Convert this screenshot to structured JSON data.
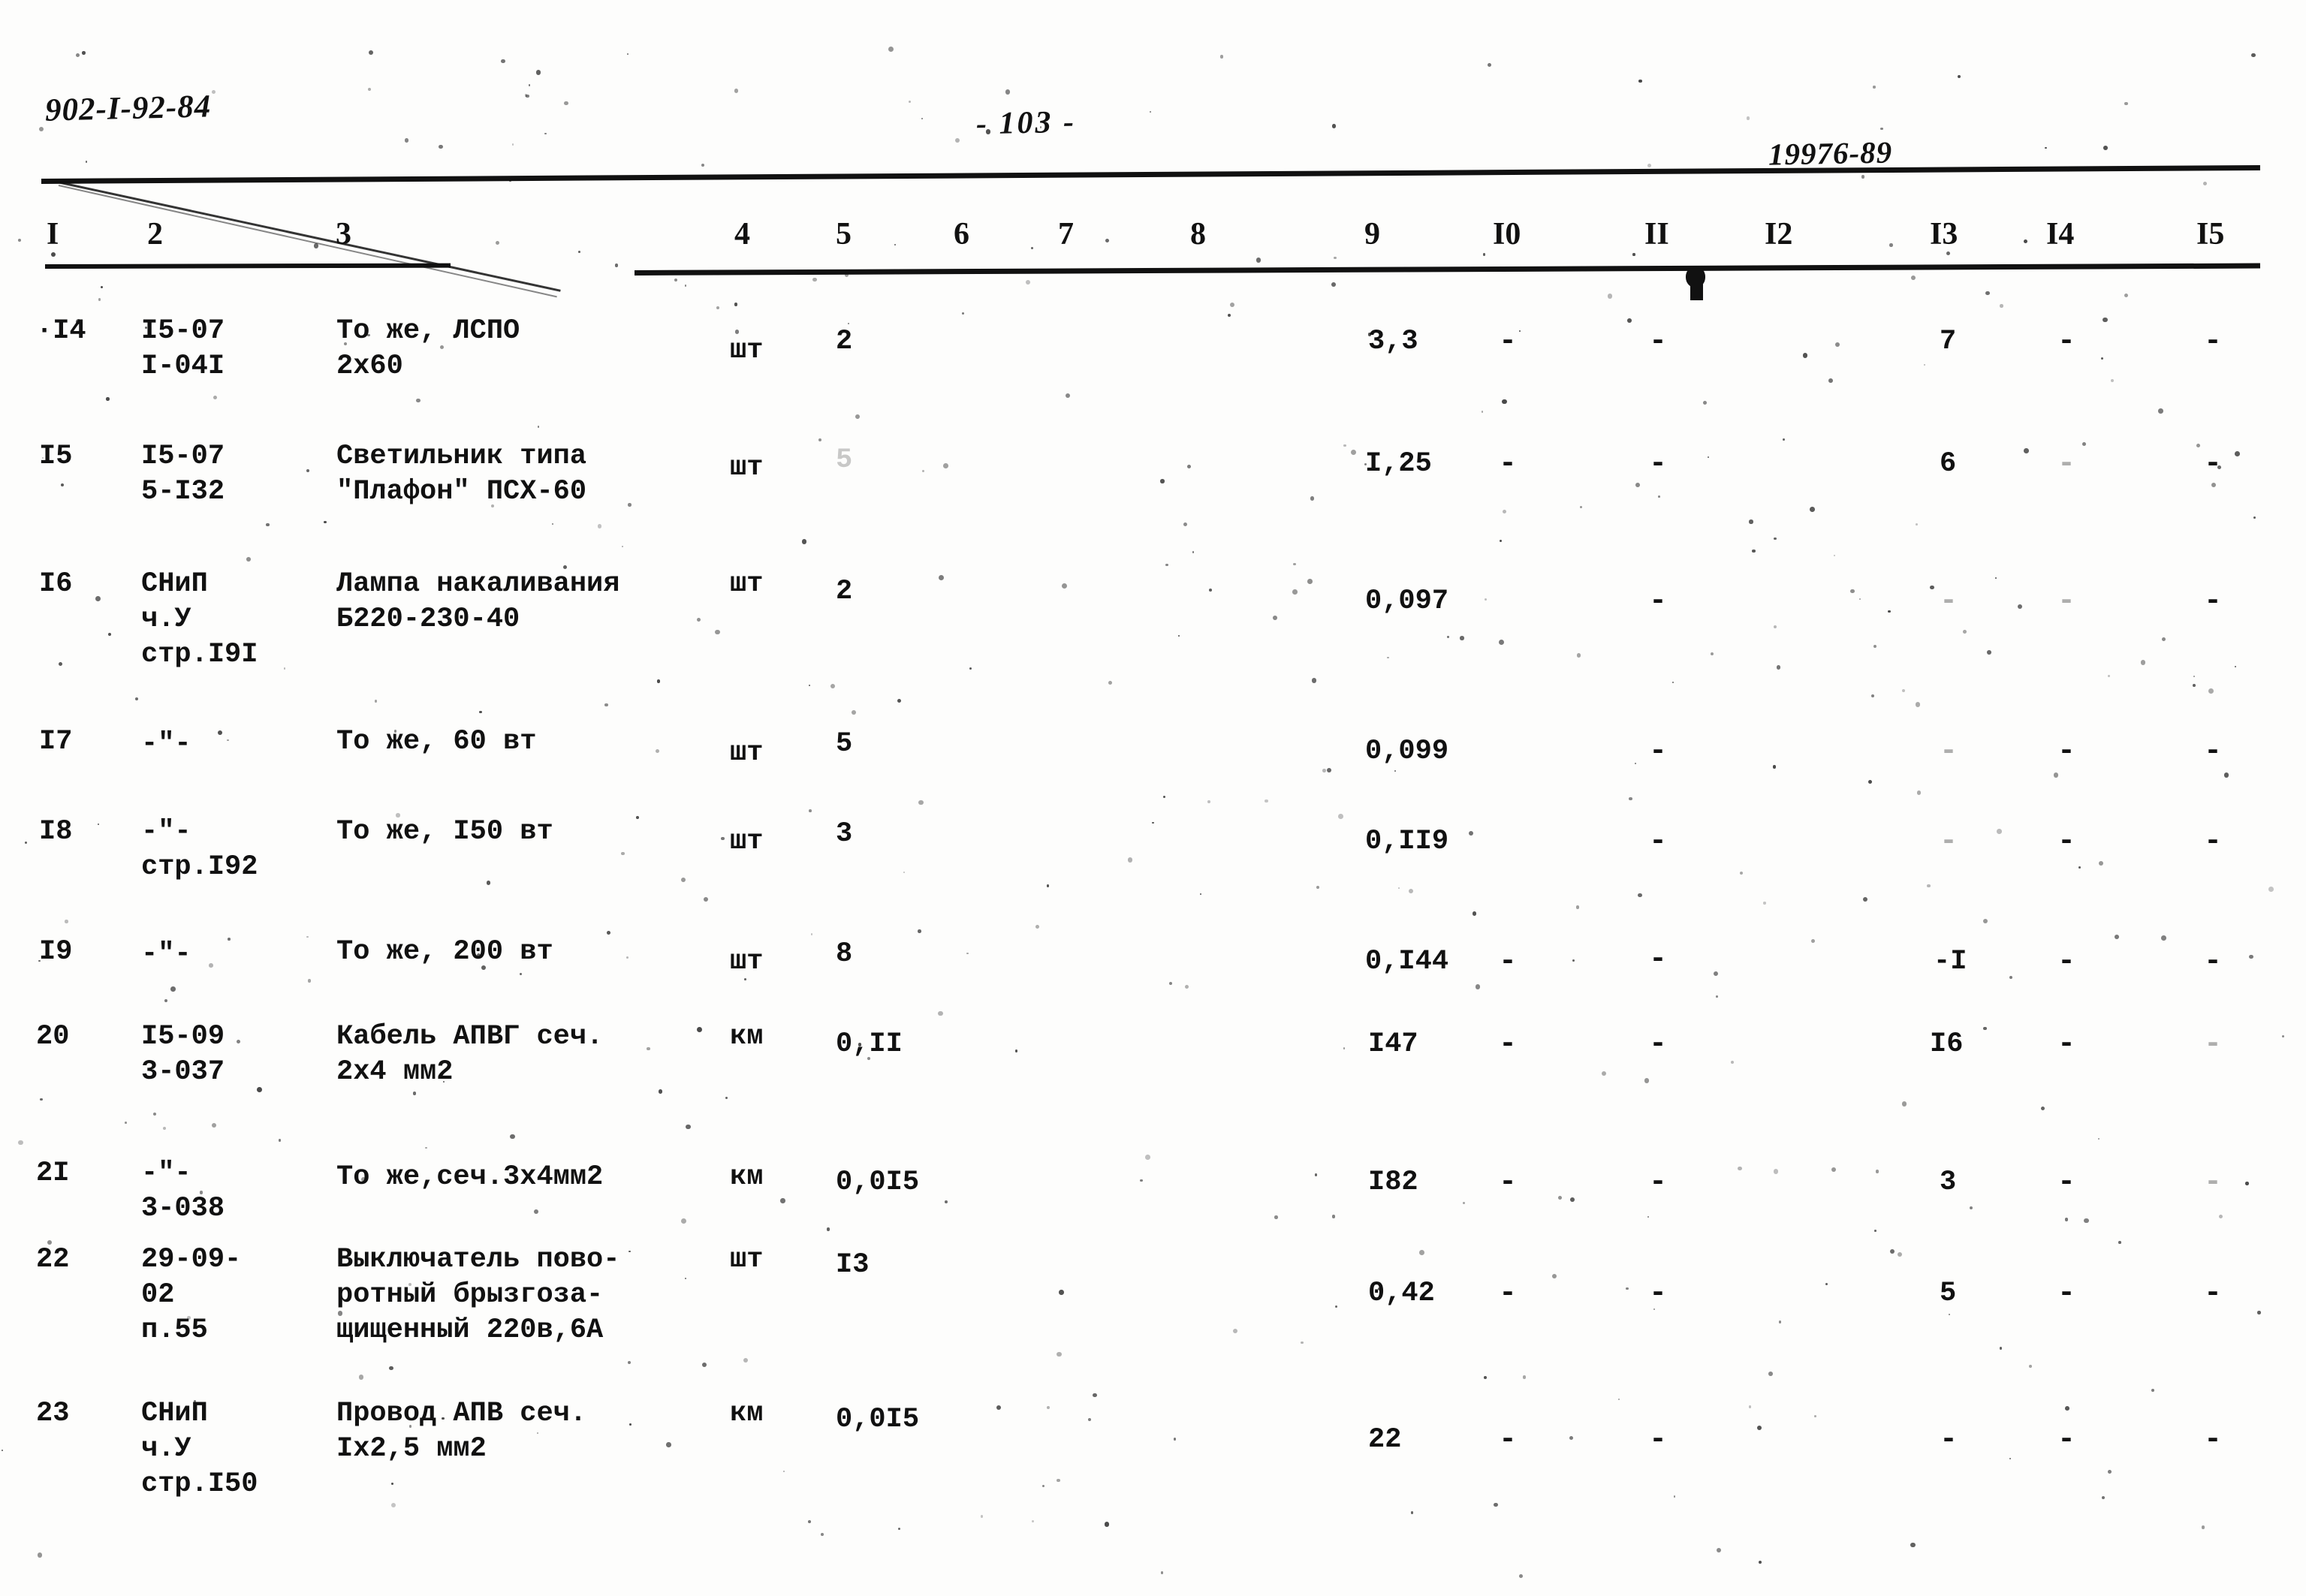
{
  "header": {
    "left_code": "902-I-92-84",
    "page_number": "- 103 -",
    "right_code": "19976-89"
  },
  "table": {
    "column_headers": [
      "I",
      "2",
      "3",
      "4",
      "5",
      "6",
      "7",
      "8",
      "9",
      "I0",
      "II",
      "I2",
      "I3",
      "I4",
      "I5"
    ],
    "rows": [
      {
        "c1": "·I4",
        "c2": "I5-07\nI-04I",
        "c3": "То же, ЛСПО\n2х60",
        "c4": "шт",
        "c5": "2",
        "c6": "",
        "c7": "",
        "c8": "",
        "c9": "3,3",
        "c10": "-",
        "c11": "-",
        "c12": "",
        "c13": "7",
        "c14": "-",
        "c15": "-"
      },
      {
        "c1": "I5",
        "c2": "I5-07\n5-I32",
        "c3": "Светильник типа\n\"Плафон\" ПСХ-60",
        "c4": "шт",
        "c5": "5",
        "c6": "",
        "c7": "",
        "c8": "",
        "c9": "I,25",
        "c10": "-",
        "c11": "-",
        "c12": "",
        "c13": "6",
        "c14": "-",
        "c15": "-"
      },
      {
        "c1": "I6",
        "c2": "СНиП\nч.У\nстр.I9I",
        "c3": "Лампа накаливания\nБ220-230-40",
        "c4": "шт",
        "c5": "2",
        "c6": "",
        "c7": "",
        "c8": "",
        "c9": "0,097",
        "c10": "",
        "c11": "-",
        "c12": "",
        "c13": "-",
        "c14": "-",
        "c15": "-"
      },
      {
        "c1": "I7",
        "c2": "-\"-",
        "c3": "То же, 60 вт",
        "c4": "шт",
        "c5": "5",
        "c6": "",
        "c7": "",
        "c8": "",
        "c9": "0,099",
        "c10": "",
        "c11": "-",
        "c12": "",
        "c13": "-",
        "c14": "-",
        "c15": "-"
      },
      {
        "c1": "I8",
        "c2": "-\"-\nстр.I92",
        "c3": "То же, I50 вт",
        "c4": "шт",
        "c5": "3",
        "c6": "",
        "c7": "",
        "c8": "",
        "c9": "0,II9",
        "c10": "",
        "c11": "-",
        "c12": "",
        "c13": "-",
        "c14": "-",
        "c15": "-"
      },
      {
        "c1": "I9",
        "c2": "-\"-",
        "c3": "То же, 200 вт",
        "c4": "шт",
        "c5": "8",
        "c6": "",
        "c7": "",
        "c8": "",
        "c9": "0,I44",
        "c10": "-",
        "c11": "-",
        "c12": "",
        "c13": "-I",
        "c14": "-",
        "c15": "-"
      },
      {
        "c1": "20",
        "c2": "I5-09\n3-037",
        "c3": "Кабель АПВГ сеч.\n2х4 мм2",
        "c4": "км",
        "c5": "0,II",
        "c6": "",
        "c7": "",
        "c8": "",
        "c9": "I47",
        "c10": "-",
        "c11": "-",
        "c12": "",
        "c13": "I6",
        "c14": "-",
        "c15": "-"
      },
      {
        "c1": "2I",
        "c2": "-\"-\n3-038",
        "c3": "То же,сеч.3х4мм2",
        "c4": "км",
        "c5": "0,0I5",
        "c6": "",
        "c7": "",
        "c8": "",
        "c9": "I82",
        "c10": "-",
        "c11": "-",
        "c12": "",
        "c13": "3",
        "c14": "-",
        "c15": "-"
      },
      {
        "c1": "22",
        "c2": "29-09-\n02\nп.55",
        "c3": "Выключатель пово-\nротный брызгоза-\nщищенный 220в,6А",
        "c4": "шт",
        "c5": "I3",
        "c6": "",
        "c7": "",
        "c8": "",
        "c9": "0,42",
        "c10": "-",
        "c11": "-",
        "c12": "",
        "c13": "5",
        "c14": "-",
        "c15": "-"
      },
      {
        "c1": "23",
        "c2": "СНиП\nч.У\nстр.I50",
        "c3": "Провод АПВ сеч.\nIх2,5 мм2",
        "c4": "км",
        "c5": "0,0I5",
        "c6": "",
        "c7": "",
        "c8": "",
        "c9": "22",
        "c10": "-",
        "c11": "-",
        "c12": "",
        "c13": "-",
        "c14": "-",
        "c15": "-"
      }
    ]
  }
}
